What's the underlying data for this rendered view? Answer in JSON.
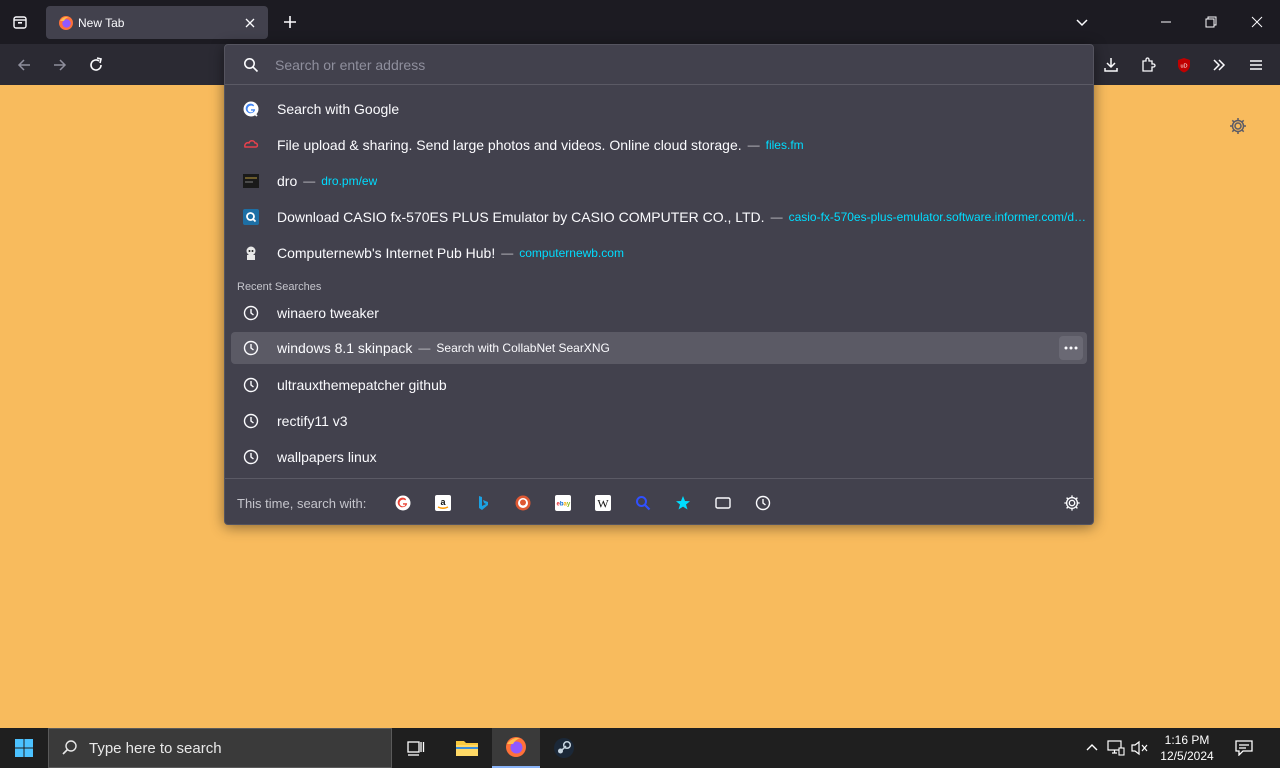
{
  "tab": {
    "title": "New Tab"
  },
  "urlbar": {
    "placeholder": "Search or enter address"
  },
  "results": [
    {
      "title": "Search with Google",
      "sep": "",
      "url": "",
      "icon": "google-icon"
    },
    {
      "title": "File upload & sharing. Send large photos and videos. Online cloud storage.",
      "sep": "—",
      "url": "files.fm",
      "icon": "filesfm-icon"
    },
    {
      "title": "dro",
      "sep": "—",
      "url": "dro.pm/ew",
      "icon": "dro-icon"
    },
    {
      "title": "Download CASIO fx-570ES PLUS Emulator by CASIO COMPUTER CO., LTD.",
      "sep": "—",
      "url": "casio-fx-570es-plus-emulator.software.informer.com/down...",
      "icon": "informer-icon"
    },
    {
      "title": "Computernewb's Internet Pub Hub!",
      "sep": "—",
      "url": "computernewb.com",
      "icon": "computernewb-icon"
    }
  ],
  "recent": {
    "label": "Recent Searches",
    "items": [
      {
        "title": "winaero tweaker",
        "sep": "",
        "action": ""
      },
      {
        "title": "windows 8.1 skinpack",
        "sep": "—",
        "action": "Search with CollabNet SearXNG"
      },
      {
        "title": "ultrauxthemepatcher github",
        "sep": "",
        "action": ""
      },
      {
        "title": "rectify11 v3",
        "sep": "",
        "action": ""
      },
      {
        "title": "wallpapers linux",
        "sep": "",
        "action": ""
      }
    ]
  },
  "oneoffs": {
    "label": "This time, search with:",
    "engines": [
      "google",
      "amazon",
      "bing",
      "duckduckgo",
      "ebay",
      "wikipedia",
      "searxng",
      "bookmarks",
      "tabs",
      "history"
    ]
  },
  "taskbar": {
    "search_placeholder": "Type here to search",
    "time": "1:16 PM",
    "date": "12/5/2024"
  }
}
